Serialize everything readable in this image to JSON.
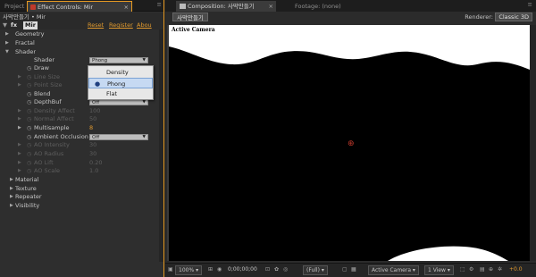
{
  "left_panel": {
    "tabs": {
      "project": "Project",
      "effect_controls": "Effect Controls: Mir"
    },
    "layer_line": "사막만들기 • Mir",
    "effect": {
      "icon": "fx",
      "name": "Mir",
      "reset": "Reset",
      "register": "Register",
      "about": "Abou"
    },
    "groups_top": [
      "Geometry",
      "Fractal",
      "Shader"
    ],
    "shader_rows": [
      {
        "label": "Shader",
        "value": "Phong",
        "kind": "dropdown",
        "dim": false
      },
      {
        "label": "Draw",
        "value": "",
        "kind": "blank",
        "dim": false
      },
      {
        "label": "Line Size",
        "value": "",
        "kind": "blank",
        "dim": true
      },
      {
        "label": "Point Size",
        "value": "",
        "kind": "blank",
        "dim": true
      },
      {
        "label": "Blend",
        "value": "",
        "kind": "blank",
        "dim": false
      },
      {
        "label": "DepthBuf",
        "value": "Off",
        "kind": "dropdown",
        "dim": false
      },
      {
        "label": "Density Affect",
        "value": "100",
        "kind": "number",
        "dim": true
      },
      {
        "label": "Normal Affect",
        "value": "50",
        "kind": "number",
        "dim": true
      },
      {
        "label": "Multisample",
        "value": "8",
        "kind": "number",
        "dim": false
      },
      {
        "label": "Ambient Occlusion",
        "value": "Off",
        "kind": "dropdown",
        "dim": false
      },
      {
        "label": "AO Intensity",
        "value": "30",
        "kind": "number",
        "dim": true
      },
      {
        "label": "AO Radius",
        "value": "30",
        "kind": "number",
        "dim": true
      },
      {
        "label": "AO Lift",
        "value": "0.20",
        "kind": "number",
        "dim": true
      },
      {
        "label": "AO Scale",
        "value": "1.0",
        "kind": "number",
        "dim": true
      }
    ],
    "groups_bottom": [
      "Material",
      "Texture",
      "Repeater",
      "Visibility"
    ],
    "shader_menu": {
      "options": [
        "Density",
        "Phong",
        "Flat"
      ],
      "selected": "Phong"
    }
  },
  "right_panel": {
    "tabs": {
      "composition": "Composition: 사막만들기",
      "footage": "Footage: (none)"
    },
    "comp_button": "사막만들기",
    "renderer_label": "Renderer:",
    "renderer_value": "Classic 3D",
    "viewer": {
      "camera_label": "Active Camera"
    },
    "bottom_bar": {
      "zoom": "100%",
      "timecode": "0;00;00;00",
      "resolution": "(Full)",
      "camera": "Active Camera",
      "views": "1 View",
      "exposure": "+0.0"
    }
  }
}
